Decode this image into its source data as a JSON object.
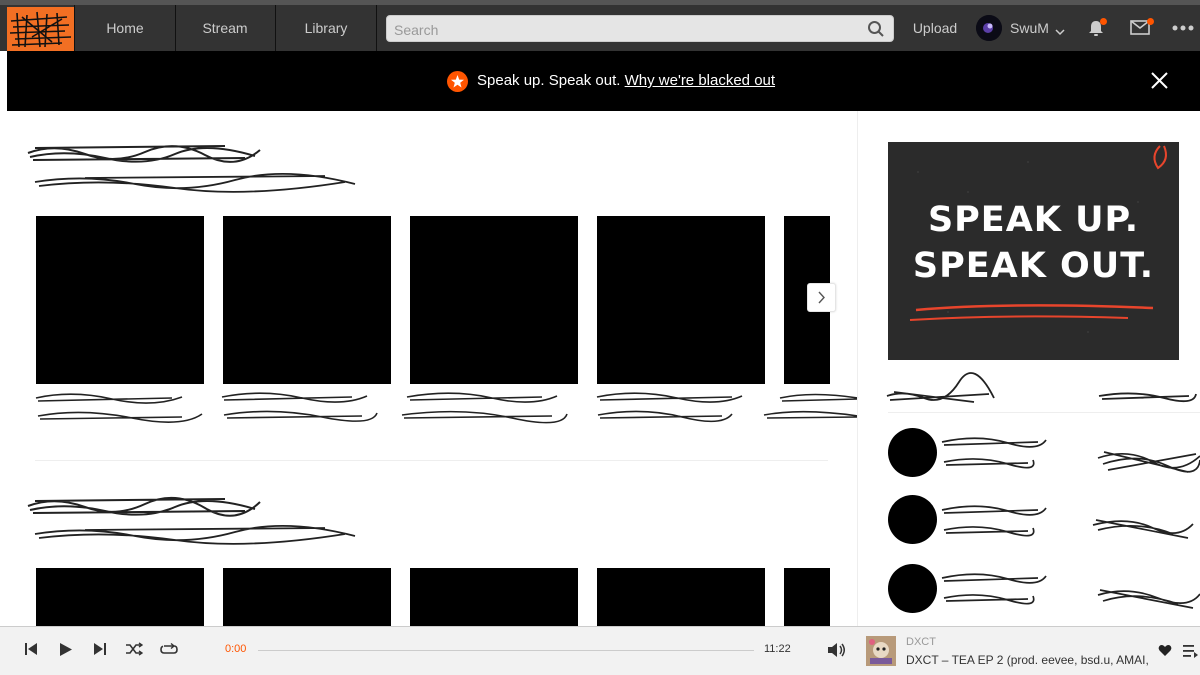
{
  "header": {
    "nav": [
      {
        "label": "Home"
      },
      {
        "label": "Stream"
      },
      {
        "label": "Library"
      }
    ],
    "search_placeholder": "Search",
    "upload_label": "Upload",
    "username": "SwuM",
    "icons": [
      "logo",
      "search-icon",
      "chevron-down-icon",
      "bell-icon",
      "mail-icon",
      "more-icon"
    ]
  },
  "banner": {
    "text": "Speak up. Speak out.",
    "link": "Why we're blacked out",
    "icons": [
      "star-icon",
      "close-icon"
    ]
  },
  "promo": {
    "line1": "SPEAK UP.",
    "line2": "SPEAK OUT."
  },
  "player": {
    "current_time": "0:00",
    "total_time": "11:22",
    "progress": 0,
    "artist": "DXCT",
    "title": "DXCT – TEA EP 2 (prod. eevee, bsd.u, AMAI, ...",
    "icons": [
      "skip-back-icon",
      "play-icon",
      "skip-forward-icon",
      "shuffle-icon",
      "repeat-icon",
      "volume-icon",
      "heart-icon",
      "queue-icon"
    ]
  },
  "colors": {
    "accent": "#ff5500",
    "header_bg": "#333333",
    "banner_bg": "#000000",
    "player_bg": "#f2f2f2"
  }
}
